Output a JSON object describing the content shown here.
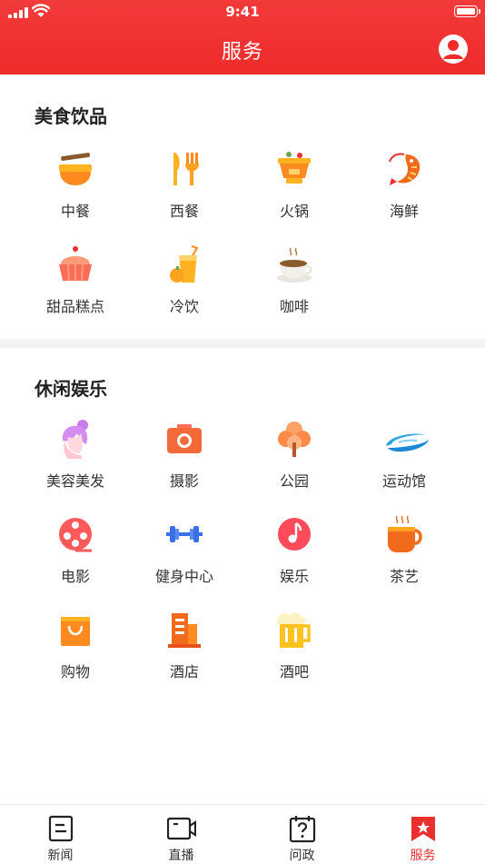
{
  "status": {
    "time": "9:41"
  },
  "header": {
    "title": "服务"
  },
  "sections": [
    {
      "title": "美食饮品",
      "items": [
        {
          "label": "中餐",
          "icon": "noodle-bowl-icon"
        },
        {
          "label": "西餐",
          "icon": "knife-fork-icon"
        },
        {
          "label": "火锅",
          "icon": "hotpot-icon"
        },
        {
          "label": "海鲜",
          "icon": "shrimp-icon"
        },
        {
          "label": "甜品糕点",
          "icon": "cupcake-icon"
        },
        {
          "label": "冷饮",
          "icon": "cold-drink-icon"
        },
        {
          "label": "咖啡",
          "icon": "coffee-cup-icon"
        }
      ]
    },
    {
      "title": "休闲娱乐",
      "items": [
        {
          "label": "美容美发",
          "icon": "hairstyle-icon"
        },
        {
          "label": "摄影",
          "icon": "camera-icon"
        },
        {
          "label": "公园",
          "icon": "tree-icon"
        },
        {
          "label": "运动馆",
          "icon": "stadium-icon"
        },
        {
          "label": "电影",
          "icon": "film-reel-icon"
        },
        {
          "label": "健身中心",
          "icon": "dumbbell-icon"
        },
        {
          "label": "娱乐",
          "icon": "music-note-icon"
        },
        {
          "label": "茶艺",
          "icon": "tea-cup-icon"
        },
        {
          "label": "购物",
          "icon": "shopping-bag-icon"
        },
        {
          "label": "酒店",
          "icon": "hotel-building-icon"
        },
        {
          "label": "酒吧",
          "icon": "beer-mug-icon"
        }
      ]
    }
  ],
  "tabbar": {
    "active_index": 3,
    "tabs": [
      {
        "label": "新闻",
        "icon": "news-icon"
      },
      {
        "label": "直播",
        "icon": "video-camera-icon"
      },
      {
        "label": "问政",
        "icon": "question-calendar-icon"
      },
      {
        "label": "服务",
        "icon": "service-bookmark-icon"
      }
    ]
  },
  "colors": {
    "brand_red": "#ee2b2b",
    "active_tab": "#e8302f",
    "divider": "#f5f3f0"
  }
}
